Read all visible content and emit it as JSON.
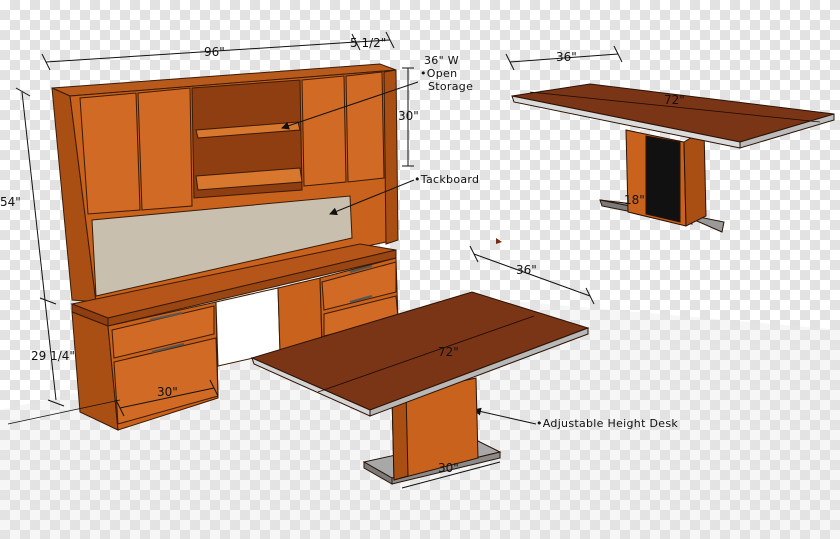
{
  "colors": {
    "wood": "#c8621c",
    "wood_dark": "#9a4612",
    "wood_light": "#d8772e",
    "desktop_top": "#7a3416",
    "tackboard": "#c9bfae",
    "base_plate": "#a8a8a8",
    "line": "#111111"
  },
  "dimensions": {
    "credenza_width": "96\"",
    "hutch_depth": "5 1/2\"",
    "total_height": "54\"",
    "hutch_height": "30\"",
    "desk_height": "29 1/4\"",
    "pedestal_width": "30\"",
    "table_top_width": "36\"",
    "table_top_length": "72\"",
    "table_base_depth": "18\"",
    "desk_top_width": "36\"",
    "desk_top_length": "72\"",
    "desk_base_width": "30\""
  },
  "callouts": {
    "open_storage_line1": "36\" W",
    "open_storage_line2": "•Open",
    "open_storage_line3": "Storage",
    "tackboard": "•Tackboard",
    "adjustable_desk": "•Adjustable Height Desk"
  }
}
